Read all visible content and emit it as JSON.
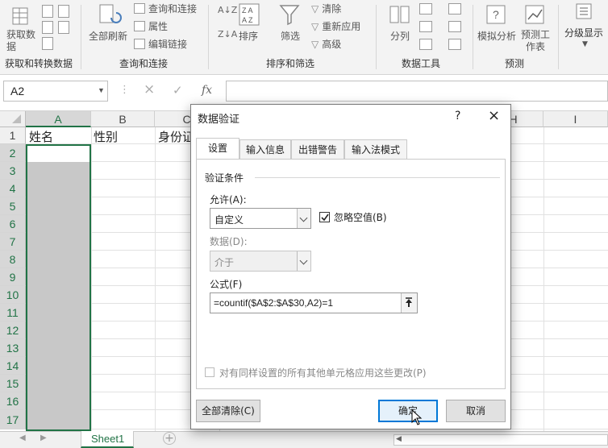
{
  "ribbon": {
    "groups": [
      {
        "label": "获取和转换数据",
        "big": "获取数据"
      },
      {
        "label": "查询和连接",
        "big": "全部刷新",
        "items": [
          "查询和连接",
          "属性",
          "编辑链接"
        ]
      },
      {
        "label": "排序和筛选",
        "sort": "排序",
        "filter": "筛选",
        "items": [
          "清除",
          "重新应用",
          "高级"
        ]
      },
      {
        "label": "数据工具",
        "big": "分列"
      },
      {
        "label": "预测",
        "big1": "模拟分析",
        "big2": "预测工作表"
      },
      {
        "label": "",
        "big": "分级显示"
      }
    ]
  },
  "formula_bar": {
    "name_box": "A2",
    "cancel_icon": "×",
    "enter_icon": "✓",
    "fx_label": "fx"
  },
  "grid": {
    "columns": [
      "A",
      "B",
      "C",
      "H",
      "I"
    ],
    "rows": [
      "1",
      "2",
      "3",
      "4",
      "5",
      "6",
      "7",
      "8",
      "9",
      "10",
      "11",
      "12",
      "13",
      "14",
      "15",
      "16",
      "17"
    ],
    "cells": {
      "A1": "姓名",
      "B1": "性别",
      "C1": "身份证"
    }
  },
  "sheet_tabs": {
    "tabs": [
      "Sheet1"
    ],
    "add_label": "+"
  },
  "dialog": {
    "title": "数据验证",
    "help": "?",
    "close": "×",
    "tabs": [
      "设置",
      "输入信息",
      "出错警告",
      "输入法模式"
    ],
    "section_title": "验证条件",
    "allow_label": "允许(A):",
    "allow_value": "自定义",
    "ignore_blank_label": "忽略空值(B)",
    "ignore_blank_checked": true,
    "data_label": "数据(D):",
    "data_value": "介于",
    "formula_label": "公式(F)",
    "formula_value": "=countif($A$2:$A$30,A2)=1",
    "apply_all_label": "对有同样设置的所有其他单元格应用这些更改(P)",
    "clear_all_button": "全部清除(C)",
    "ok_button": "确定",
    "cancel_button": "取消"
  }
}
